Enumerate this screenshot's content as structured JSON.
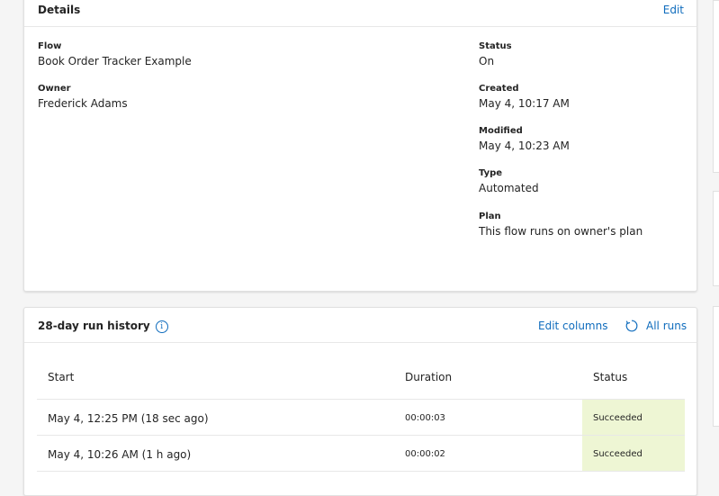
{
  "details": {
    "title": "Details",
    "edit_label": "Edit",
    "flow_label": "Flow",
    "flow_value": "Book Order Tracker Example",
    "owner_label": "Owner",
    "owner_value": "Frederick Adams",
    "status_label": "Status",
    "status_value": "On",
    "created_label": "Created",
    "created_value": "May 4, 10:17 AM",
    "modified_label": "Modified",
    "modified_value": "May 4, 10:23 AM",
    "type_label": "Type",
    "type_value": "Automated",
    "plan_label": "Plan",
    "plan_value": "This flow runs on owner's plan"
  },
  "history": {
    "title": "28-day run history",
    "edit_columns_label": "Edit columns",
    "all_runs_label": "All runs",
    "columns": [
      "Start",
      "Duration",
      "Status"
    ],
    "rows": [
      {
        "start": "May 4, 12:25 PM (18 sec ago)",
        "duration": "00:00:03",
        "status": "Succeeded"
      },
      {
        "start": "May 4, 10:26 AM (1 h ago)",
        "duration": "00:00:02",
        "status": "Succeeded"
      }
    ]
  },
  "colors": {
    "link": "#0f6cbd",
    "succeeded_bg": "#eef6d4"
  },
  "icons": {
    "info": "info-icon",
    "refresh": "refresh-icon"
  }
}
